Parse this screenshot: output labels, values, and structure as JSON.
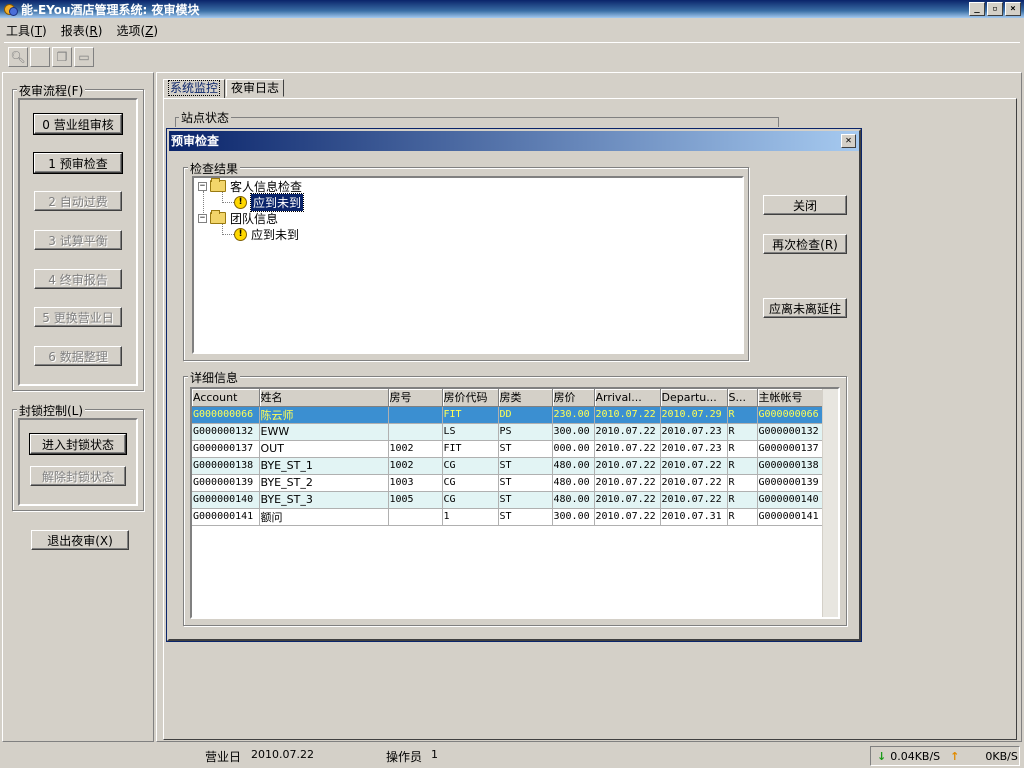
{
  "window": {
    "title": "能-EYou酒店管理系统: 夜审模块"
  },
  "menu": [
    {
      "label": "工具(",
      "key": "T",
      "close": ")"
    },
    {
      "label": "报表(",
      "key": "R",
      "close": ")"
    },
    {
      "label": "选项(",
      "key": "Z",
      "close": ")"
    }
  ],
  "toolbar": {
    "icons": [
      "search-icon",
      "blank-icon",
      "copy-icon",
      "window-icon"
    ]
  },
  "left": {
    "flow_label": "夜审流程(F)",
    "steps": [
      {
        "label": "0 营业组审核",
        "enabled": true
      },
      {
        "label": "1 预审检查",
        "enabled": true
      },
      {
        "label": "2 自动过费",
        "enabled": false
      },
      {
        "label": "3 试算平衡",
        "enabled": false
      },
      {
        "label": "4 终审报告",
        "enabled": false
      },
      {
        "label": "5 更换营业日",
        "enabled": false
      },
      {
        "label": "6 数据整理",
        "enabled": false
      }
    ],
    "lock_label": "封锁控制(L)",
    "lock_enter": "进入封锁状态",
    "lock_release": "解除封锁状态",
    "exit": "退出夜审(X)"
  },
  "main": {
    "tabs": [
      "系统监控",
      "夜审日志"
    ],
    "active_tab": "系统监控",
    "station_status": "站点状态"
  },
  "dialog": {
    "title": "预审检查",
    "close_glyph": "✕",
    "results_label": "检查结果",
    "tree": [
      {
        "label": "客人信息检查",
        "children": [
          "应到未到"
        ]
      },
      {
        "label": "团队信息",
        "children": [
          "应到未到"
        ]
      }
    ],
    "buttons": {
      "close": "关闭",
      "recheck": "再次检查(R)",
      "extend": "应离未离延住"
    },
    "detail_label": "详细信息",
    "columns": [
      "Account",
      "姓名",
      "房号",
      "房价代码",
      "房类",
      "房价",
      "Arrival...",
      "Departu...",
      "S...",
      "主帐帐号"
    ],
    "rows": [
      [
        "G000000066",
        "陈云师",
        "",
        "FIT",
        "DD",
        "230.00",
        "2010.07.22",
        "2010.07.29",
        "R",
        "G000000066"
      ],
      [
        "G000000132",
        "EWW",
        "",
        "LS",
        "PS",
        "300.00",
        "2010.07.22",
        "2010.07.23",
        "R",
        "G000000132"
      ],
      [
        "G000000137",
        "OUT",
        "1002",
        "FIT",
        "ST",
        "000.00",
        "2010.07.22",
        "2010.07.23",
        "R",
        "G000000137"
      ],
      [
        "G000000138",
        "BYE_ST_1",
        "1002",
        "CG",
        "ST",
        "480.00",
        "2010.07.22",
        "2010.07.22",
        "R",
        "G000000138"
      ],
      [
        "G000000139",
        "BYE_ST_2",
        "1003",
        "CG",
        "ST",
        "480.00",
        "2010.07.22",
        "2010.07.22",
        "R",
        "G000000139"
      ],
      [
        "G000000140",
        "BYE_ST_3",
        "1005",
        "CG",
        "ST",
        "480.00",
        "2010.07.22",
        "2010.07.22",
        "R",
        "G000000140"
      ],
      [
        "G000000141",
        "额问",
        "",
        "1",
        "ST",
        "300.00",
        "2010.07.22",
        "2010.07.31",
        "R",
        "G000000141"
      ]
    ],
    "selected_row": 0
  },
  "status": {
    "business_day_label": "营业日",
    "business_day": "2010.07.22",
    "operator_label": "操作员",
    "operator": "1",
    "download": "0.04KB/S",
    "upload": "0KB/S"
  }
}
